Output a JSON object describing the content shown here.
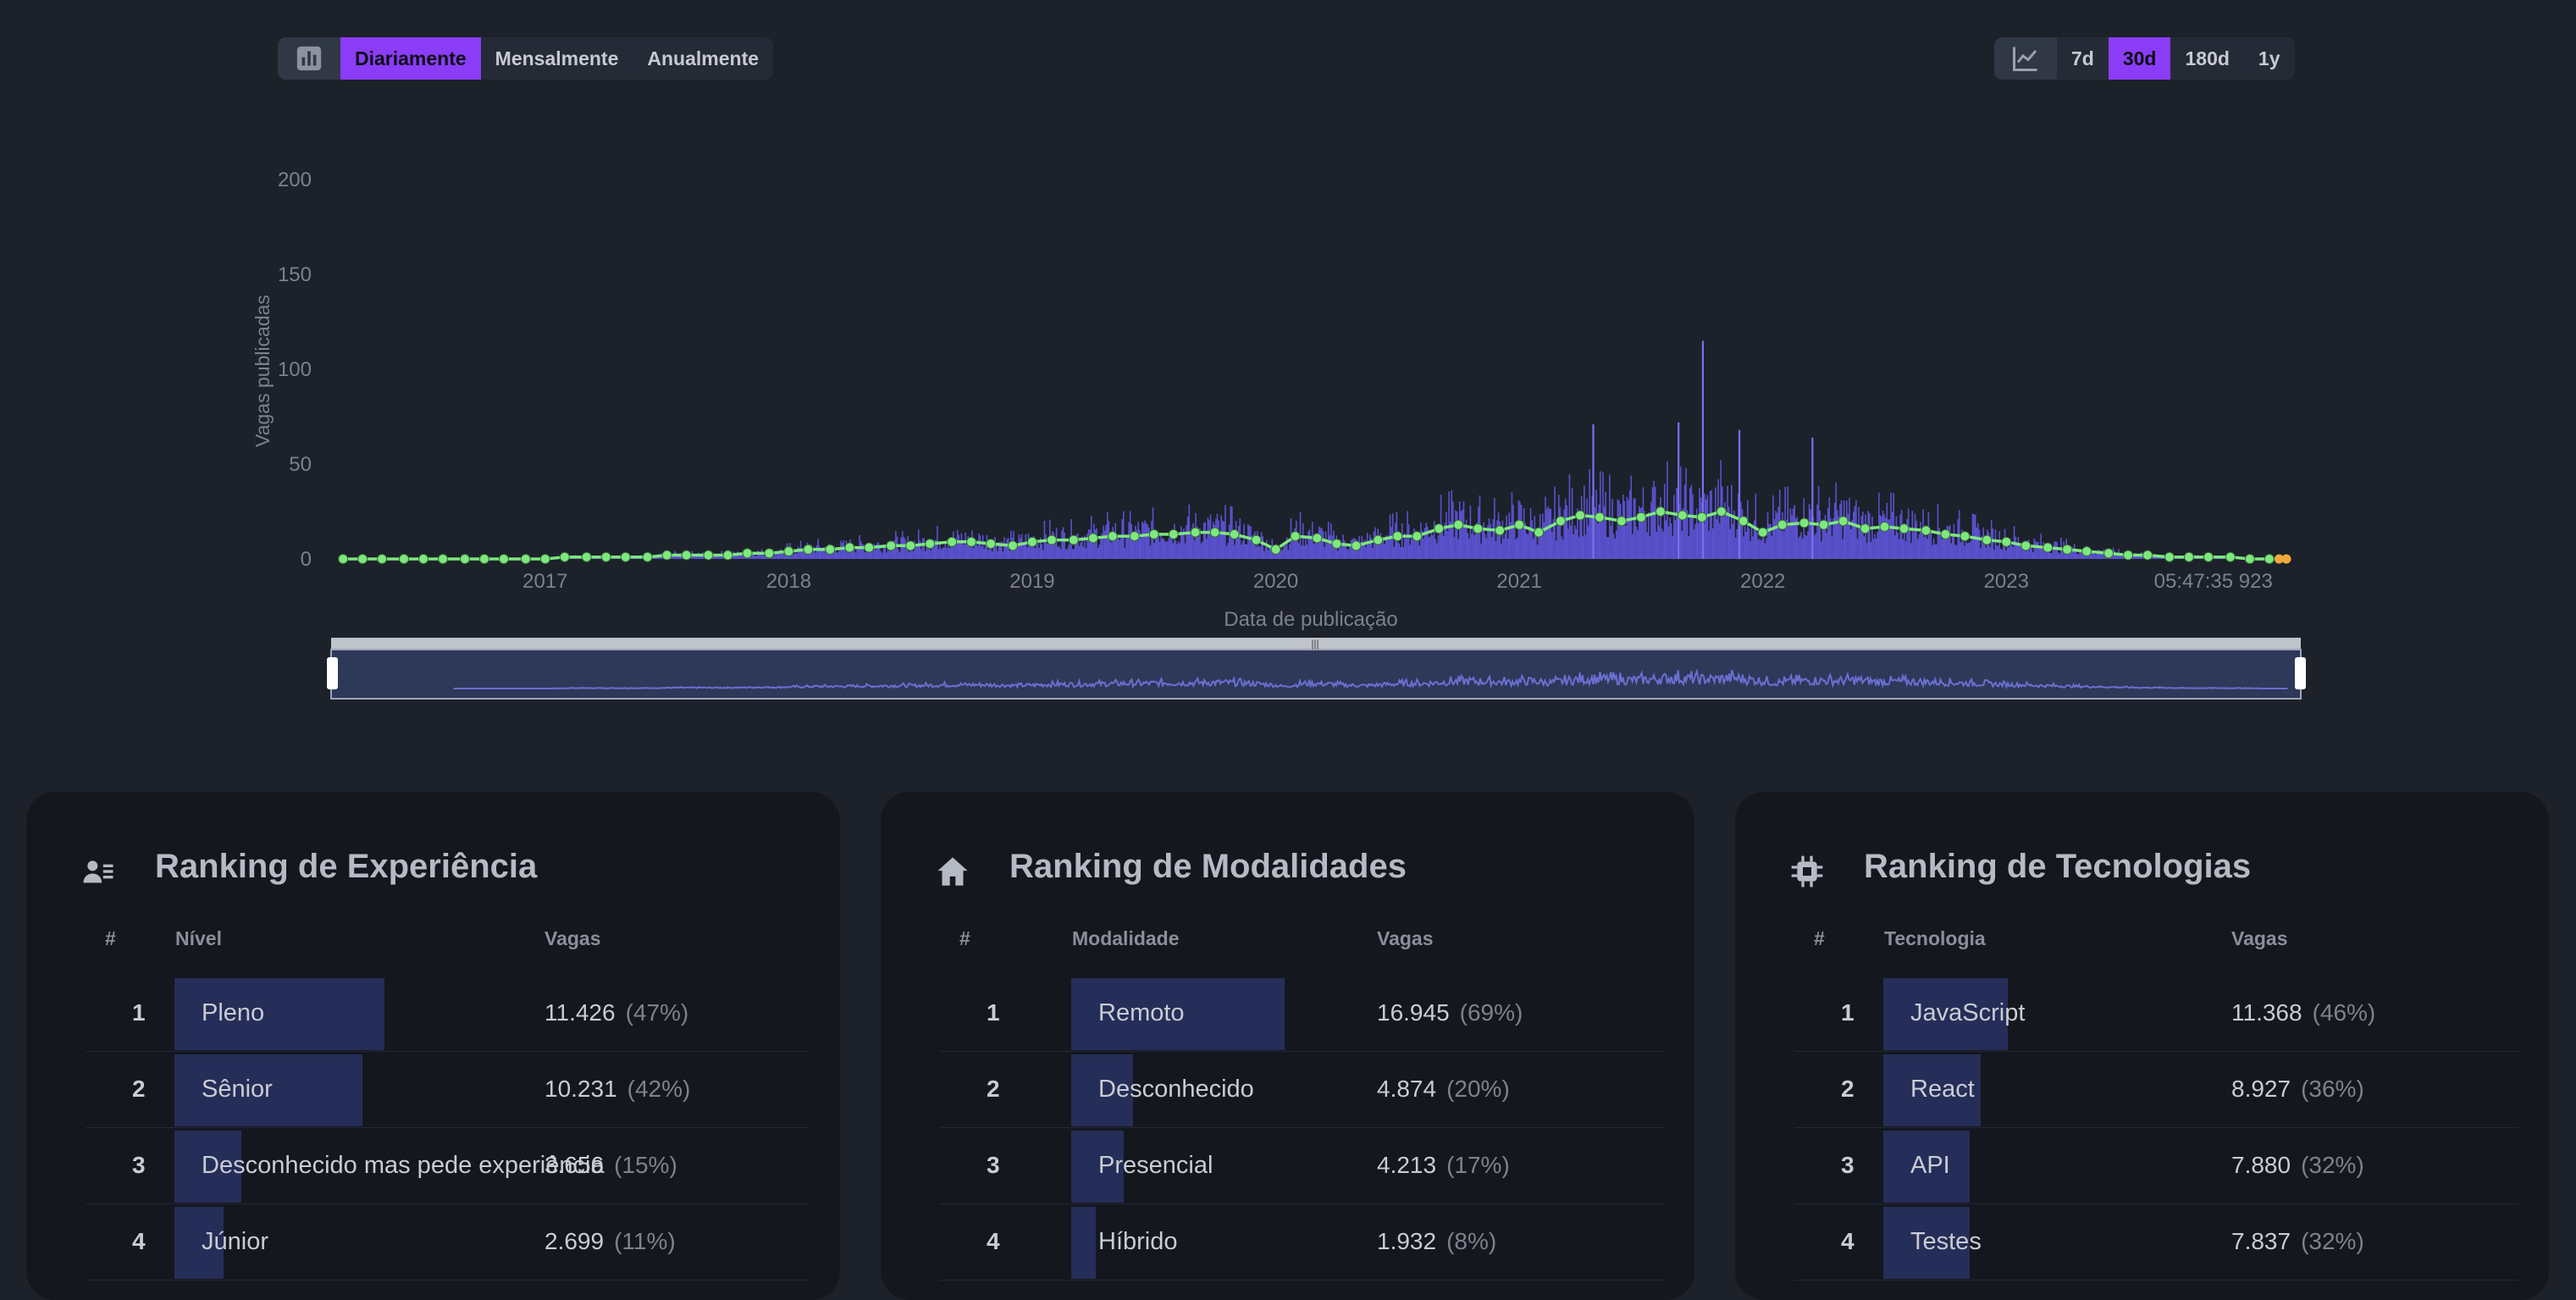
{
  "left_group": {
    "icon": "bar-chart-icon",
    "options": [
      {
        "label": "Diariamente",
        "active": true
      },
      {
        "label": "Mensalmente",
        "active": false
      },
      {
        "label": "Anualmente",
        "active": false
      }
    ]
  },
  "right_group": {
    "icon": "line-chart-icon",
    "options": [
      {
        "label": "7d",
        "active": false
      },
      {
        "label": "30d",
        "active": true
      },
      {
        "label": "180d",
        "active": false
      },
      {
        "label": "1y",
        "active": false
      }
    ]
  },
  "chart_data": {
    "type": "bar",
    "ylabel": "Vagas publicadas",
    "xlabel": "Data de publicação",
    "ylim": [
      0,
      200
    ],
    "y_ticks": [
      "0",
      "50",
      "100",
      "150",
      "200"
    ],
    "x_ticks": [
      "2017",
      "2018",
      "2019",
      "2020",
      "2021",
      "2022",
      "2023",
      "05:47:35 923"
    ],
    "x_range": [
      2016.1,
      2024.15
    ],
    "bar_color": "#6257e0",
    "line_color": "#7ee87e",
    "series": [
      {
        "kind": "moving-average",
        "x": [
          2016.17,
          2016.25,
          2016.33,
          2016.42,
          2016.5,
          2016.58,
          2016.67,
          2016.75,
          2016.83,
          2016.92,
          2017.0,
          2017.08,
          2017.17,
          2017.25,
          2017.33,
          2017.42,
          2017.5,
          2017.58,
          2017.67,
          2017.75,
          2017.83,
          2017.92,
          2018.0,
          2018.08,
          2018.17,
          2018.25,
          2018.33,
          2018.42,
          2018.5,
          2018.58,
          2018.67,
          2018.75,
          2018.83,
          2018.92,
          2019.0,
          2019.08,
          2019.17,
          2019.25,
          2019.33,
          2019.42,
          2019.5,
          2019.58,
          2019.67,
          2019.75,
          2019.83,
          2019.92,
          2020.0,
          2020.08,
          2020.17,
          2020.25,
          2020.33,
          2020.42,
          2020.5,
          2020.58,
          2020.67,
          2020.75,
          2020.83,
          2020.92,
          2021.0,
          2021.08,
          2021.17,
          2021.25,
          2021.33,
          2021.42,
          2021.5,
          2021.58,
          2021.67,
          2021.75,
          2021.83,
          2021.92,
          2022.0,
          2022.08,
          2022.17,
          2022.25,
          2022.33,
          2022.42,
          2022.5,
          2022.58,
          2022.67,
          2022.75,
          2022.83,
          2022.92,
          2023.0,
          2023.08,
          2023.17,
          2023.25,
          2023.33,
          2023.42,
          2023.5,
          2023.58,
          2023.67,
          2023.75,
          2023.83,
          2023.92,
          2024.0,
          2024.08
        ],
        "y": [
          0,
          0,
          0,
          0,
          0,
          0,
          0,
          0,
          0,
          0,
          0,
          1,
          1,
          1,
          1,
          1,
          2,
          2,
          2,
          2,
          3,
          3,
          4,
          5,
          5,
          6,
          6,
          7,
          7,
          8,
          9,
          9,
          8,
          7,
          9,
          10,
          10,
          11,
          12,
          12,
          13,
          13,
          14,
          14,
          13,
          10,
          5,
          12,
          11,
          8,
          7,
          10,
          12,
          12,
          16,
          18,
          16,
          15,
          18,
          14,
          20,
          23,
          22,
          20,
          22,
          25,
          23,
          22,
          25,
          20,
          14,
          18,
          19,
          18,
          20,
          16,
          17,
          16,
          15,
          13,
          12,
          10,
          9,
          7,
          6,
          5,
          4,
          3,
          2,
          2,
          1,
          1,
          1,
          1,
          0,
          0
        ]
      },
      {
        "kind": "daily-peaks",
        "x": [
          2021.75,
          2021.65,
          2021.9,
          2022.2,
          2021.3
        ],
        "y": [
          115,
          72,
          68,
          64,
          71
        ]
      }
    ]
  },
  "panels": [
    {
      "icon": "users-list-icon",
      "title": "Ranking de Experiência",
      "col_rank": "#",
      "col_name": "Nível",
      "col_value": "Vagas",
      "rows": [
        {
          "rank": "1",
          "name": "Pleno",
          "value": "11.426",
          "pct": "(47%)",
          "share": 0.47
        },
        {
          "rank": "2",
          "name": "Sênior",
          "value": "10.231",
          "pct": "(42%)",
          "share": 0.42
        },
        {
          "rank": "3",
          "name": "Desconhecido mas pede experiência",
          "value": "3.656",
          "pct": "(15%)",
          "share": 0.15
        },
        {
          "rank": "4",
          "name": "Júnior",
          "value": "2.699",
          "pct": "(11%)",
          "share": 0.11
        }
      ]
    },
    {
      "icon": "home-icon",
      "title": "Ranking de Modalidades",
      "col_rank": "#",
      "col_name": "Modalidade",
      "col_value": "Vagas",
      "rows": [
        {
          "rank": "1",
          "name": "Remoto",
          "value": "16.945",
          "pct": "(69%)",
          "share": 0.69
        },
        {
          "rank": "2",
          "name": "Desconhecido",
          "value": "4.874",
          "pct": "(20%)",
          "share": 0.2
        },
        {
          "rank": "3",
          "name": "Presencial",
          "value": "4.213",
          "pct": "(17%)",
          "share": 0.17
        },
        {
          "rank": "4",
          "name": "Híbrido",
          "value": "1.932",
          "pct": "(8%)",
          "share": 0.08
        }
      ]
    },
    {
      "icon": "chip-icon",
      "title": "Ranking de Tecnologias",
      "col_rank": "#",
      "col_name": "Tecnologia",
      "col_value": "Vagas",
      "rows": [
        {
          "rank": "1",
          "name": "JavaScript",
          "value": "11.368",
          "pct": "(46%)",
          "share": 0.46
        },
        {
          "rank": "2",
          "name": "React",
          "value": "8.927",
          "pct": "(36%)",
          "share": 0.36
        },
        {
          "rank": "3",
          "name": "API",
          "value": "7.880",
          "pct": "(32%)",
          "share": 0.32
        },
        {
          "rank": "4",
          "name": "Testes",
          "value": "7.837",
          "pct": "(32%)",
          "share": 0.32
        }
      ]
    }
  ]
}
